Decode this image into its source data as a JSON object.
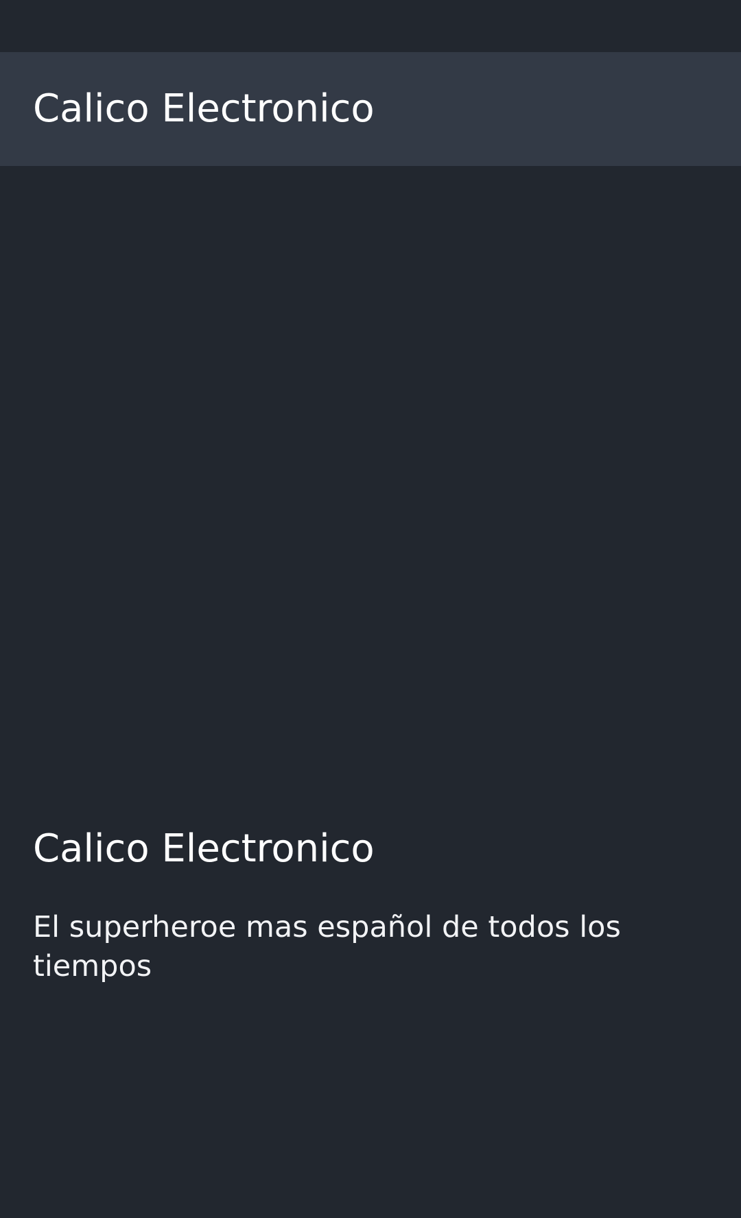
{
  "app_bar": {
    "title": "Calico Electronico"
  },
  "content": {
    "title": "Calico Electronico",
    "subtitle": "El superheroe mas español de todos los tiempos"
  },
  "colors": {
    "background": "#22272f",
    "app_bar": "#333a46",
    "text": "#ffffff"
  }
}
